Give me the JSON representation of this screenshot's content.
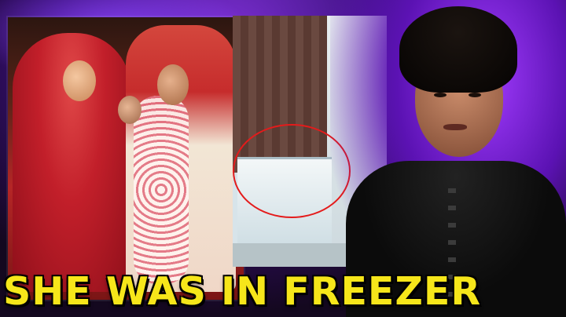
{
  "thumbnail": {
    "headline": "SHE WAS IN FREEZER",
    "headline_color": "#f6e61a",
    "accent_color": "#7a2fd0",
    "highlight_circle_color": "#e41b1b"
  },
  "panels": [
    {
      "name": "wedding-photo"
    },
    {
      "name": "cctv-freezer"
    },
    {
      "name": "host-portrait"
    }
  ]
}
